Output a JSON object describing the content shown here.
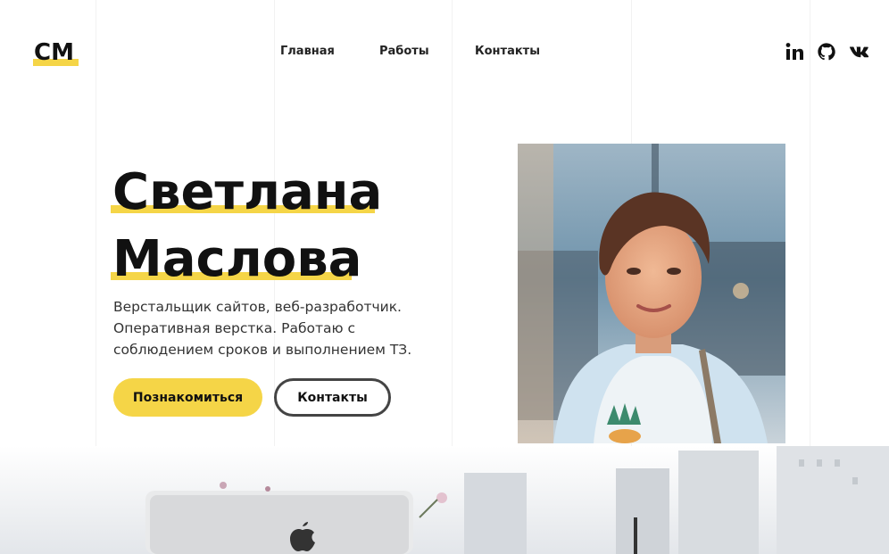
{
  "logo": {
    "text": "СМ"
  },
  "nav": [
    {
      "label": "Главная"
    },
    {
      "label": "Работы"
    },
    {
      "label": "Контакты"
    }
  ],
  "social": [
    {
      "icon": "linkedin-icon"
    },
    {
      "icon": "github-icon"
    },
    {
      "icon": "vk-icon"
    }
  ],
  "hero": {
    "first_name": "Светлана",
    "last_name": "Маслова",
    "description": [
      "Верстальщик сайтов, веб-разработчик.",
      "Оперативная верстка. Работаю с",
      "соблюдением сроков и выполнением ТЗ."
    ],
    "primary_button": "Познакомиться",
    "secondary_button": "Контакты"
  },
  "colors": {
    "accent": "#f5d547",
    "text": "#111111",
    "outline": "#444444"
  }
}
